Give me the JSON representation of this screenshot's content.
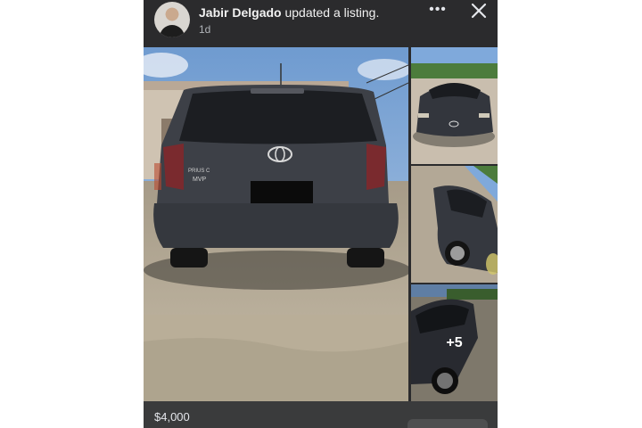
{
  "post": {
    "author": "Jabir Delgado",
    "action": "updated a listing.",
    "time": "1d",
    "more_label": "•••",
    "photos_more": "+5",
    "price": "$4,000"
  },
  "car": {
    "badge_model": "PRIUS C",
    "badge_trim": "MVP"
  },
  "colors": {
    "background": "#2b2b2d",
    "header_text": "#f2f2f2",
    "secondary_text": "#b0b3b8",
    "car_body": "#3d4047"
  },
  "icons": [
    "avatar",
    "more-icon",
    "close-icon"
  ]
}
